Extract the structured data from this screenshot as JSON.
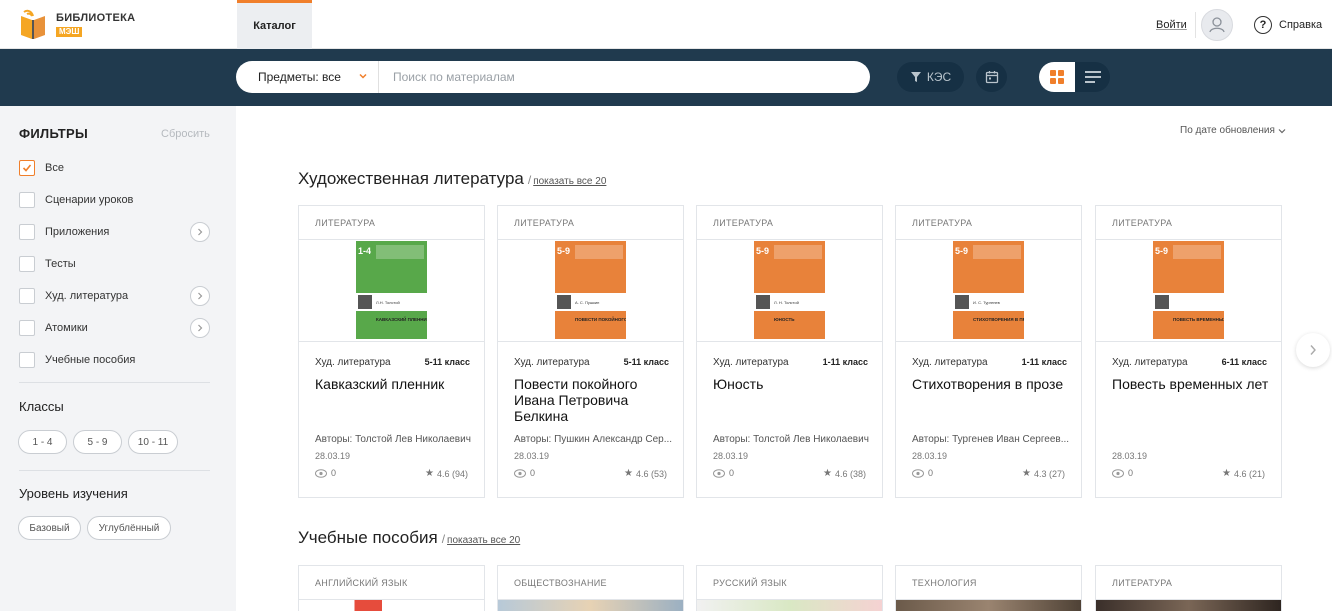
{
  "header": {
    "logo_line1": "БИБЛИОТЕКА",
    "logo_line2": "МЭШ",
    "tab_catalog": "Каталог",
    "login": "Войти",
    "help": "Справка"
  },
  "search": {
    "subject_select": "Предметы: все",
    "placeholder": "Поиск по материалам",
    "kes_label": "КЭС"
  },
  "colors": {
    "accent": "#f07f2b",
    "navbar": "#203a4e"
  },
  "sidebar": {
    "title": "ФИЛЬТРЫ",
    "reset": "Сбросить",
    "types": [
      {
        "label": "Все",
        "checked": true,
        "has_arrow": false
      },
      {
        "label": "Сценарии уроков",
        "checked": false,
        "has_arrow": false
      },
      {
        "label": "Приложения",
        "checked": false,
        "has_arrow": true
      },
      {
        "label": "Тесты",
        "checked": false,
        "has_arrow": false
      },
      {
        "label": "Худ. литература",
        "checked": false,
        "has_arrow": true
      },
      {
        "label": "Атомики",
        "checked": false,
        "has_arrow": true
      },
      {
        "label": "Учебные пособия",
        "checked": false,
        "has_arrow": false
      }
    ],
    "classes_title": "Классы",
    "classes": [
      "1 - 4",
      "5 - 9",
      "10 - 11"
    ],
    "level_title": "Уровень изучения",
    "levels": [
      "Базовый",
      "Углублённый"
    ]
  },
  "main": {
    "sort_label": "По дате обновления",
    "sections": [
      {
        "title": "Художественная литература",
        "show_all": "показать все 20",
        "cards": [
          {
            "subject": "ЛИТЕРАТУРА",
            "type": "Худ. литература",
            "grade": "5-11 класс",
            "title": "Кавказский пленник",
            "authors": "Авторы: Толстой Лев Николаевич",
            "date": "28.03.19",
            "views": "0",
            "rating": "4.6 (94)",
            "cover_color": "#58a84a",
            "cover_badge": "1-4",
            "cover_author": "Л.Н. Толстой",
            "cover_title": "КАВКАЗСКИЙ ПЛЕННИК"
          },
          {
            "subject": "ЛИТЕРАТУРА",
            "type": "Худ. литература",
            "grade": "5-11 класс",
            "title": "Повести покойного Ивана Петровича Белкина",
            "authors": "Авторы: Пушкин Александр Сер...",
            "date": "28.03.19",
            "views": "0",
            "rating": "4.6 (53)",
            "cover_color": "#e8823a",
            "cover_badge": "5-9",
            "cover_author": "А. С. Пушкин",
            "cover_title": "ПОВЕСТИ ПОКОЙНОГО ИВАНА ПЕТРОВИЧА БЕЛКИНА"
          },
          {
            "subject": "ЛИТЕРАТУРА",
            "type": "Худ. литература",
            "grade": "1-11 класс",
            "title": "Юность",
            "authors": "Авторы: Толстой Лев Николаевич",
            "date": "28.03.19",
            "views": "0",
            "rating": "4.6 (38)",
            "cover_color": "#e8823a",
            "cover_badge": "5-9",
            "cover_author": "Л. Н. Толстой",
            "cover_title": "ЮНОСТЬ"
          },
          {
            "subject": "ЛИТЕРАТУРА",
            "type": "Худ. литература",
            "grade": "1-11 класс",
            "title": "Стихотворения в прозе",
            "authors": "Авторы: Тургенев Иван Сергеев...",
            "date": "28.03.19",
            "views": "0",
            "rating": "4.3 (27)",
            "cover_color": "#e8823a",
            "cover_badge": "5-9",
            "cover_author": "И. С. Тургенев",
            "cover_title": "СТИХОТВОРЕНИЯ В ПРОЗЕ"
          },
          {
            "subject": "ЛИТЕРАТУРА",
            "type": "Худ. литература",
            "grade": "6-11 класс",
            "title": "Повесть временных лет",
            "authors": "",
            "date": "28.03.19",
            "views": "0",
            "rating": "4.6 (21)",
            "cover_color": "#e8823a",
            "cover_badge": "5-9",
            "cover_author": "",
            "cover_title": "ПОВЕСТЬ ВРЕМЕННЫХ ЛЕТ"
          }
        ]
      },
      {
        "title": "Учебные пособия",
        "show_all": "показать все 20",
        "cards": [
          {
            "subject": "АНГЛИЙСКИЙ ЯЗЫК"
          },
          {
            "subject": "ОБЩЕСТВОЗНАНИЕ"
          },
          {
            "subject": "РУССКИЙ ЯЗЫК"
          },
          {
            "subject": "ТЕХНОЛОГИЯ"
          },
          {
            "subject": "ЛИТЕРАТУРА"
          }
        ]
      }
    ]
  }
}
